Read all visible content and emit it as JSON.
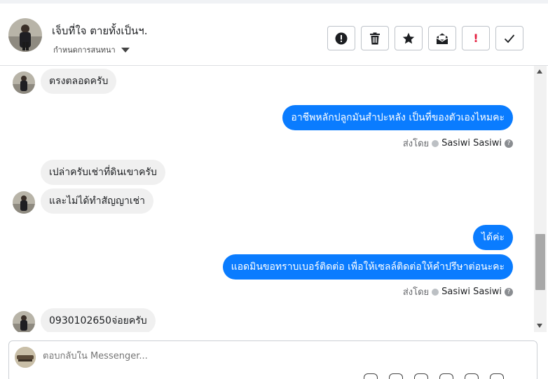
{
  "header": {
    "name": "เจ็บที่ใจ ตายทั้งเป็นฯ.",
    "label": "กำหนดการสนทนา"
  },
  "toolbar": {
    "icons": [
      "exclamation-circle-icon",
      "trash-icon",
      "star-icon",
      "mark-unread-icon",
      "spam-flag-icon",
      "checkmark-icon"
    ],
    "spam_glyph": "!"
  },
  "messages": [
    {
      "side": "in",
      "text": "ตรงตลอดครับ"
    },
    {
      "side": "out",
      "text": "อาชีพหลักปลูกมันสำปะหลัง เป็นที่ของตัวเองไหมคะ"
    },
    {
      "side": "sentby",
      "prefix": "ส่งโดย",
      "name": "Sasiwi Sasiwi",
      "q": "?"
    },
    {
      "side": "in",
      "text": "เปล่าครับเช่าที่ดินเขาครับ"
    },
    {
      "side": "in",
      "text": "และไม่ได้ทำสัญญาเช่า"
    },
    {
      "side": "out",
      "text": "ได้ค่ะ"
    },
    {
      "side": "out",
      "text": "แอดมินขอทราบเบอร์ติดต่อ เพื่อให้เซลล์ติดต่อให้คำปรึษาต่อนะคะ"
    },
    {
      "side": "sentby",
      "prefix": "ส่งโดย",
      "name": "Sasiwi Sasiwi",
      "q": "?"
    },
    {
      "side": "in",
      "text": "0930102650จ่อยครับ"
    }
  ],
  "composer": {
    "placeholder": "ตอบกลับใน Messenger..."
  },
  "colors": {
    "outgoing_bubble": "#0a7cff",
    "incoming_bubble": "#f0f0f0",
    "spam_red": "#e41e3f"
  }
}
